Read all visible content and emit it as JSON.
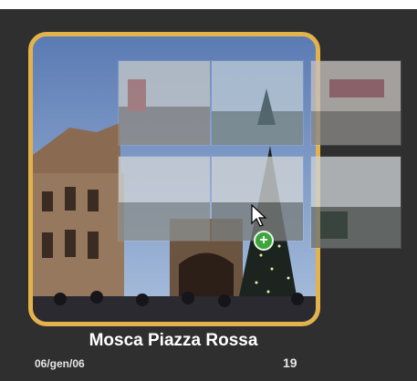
{
  "event": {
    "title": "Mosca Piazza Rossa",
    "date": "06/gen/06",
    "photo_count": "19"
  },
  "icons": {
    "cursor": "arrow-pointer-icon",
    "add": "plus-badge-icon"
  },
  "colors": {
    "selection_border": "#e4b24b",
    "background": "#2f2f2f",
    "add_badge": "#3fa43b"
  }
}
